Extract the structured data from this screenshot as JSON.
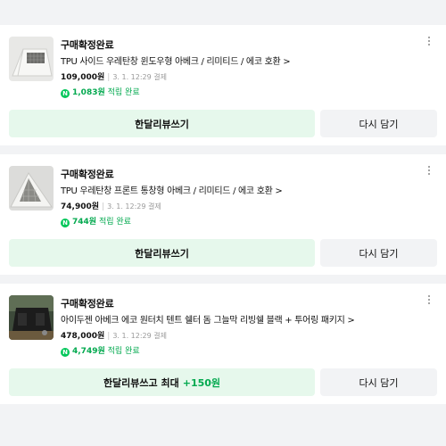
{
  "orders": [
    {
      "status": "구매확정완료",
      "title": "TPU 사이드 우레탄창 윈도우형 아베크 / 리미티드 / 에코 호환 >",
      "price": "109,000원",
      "date": "3. 1. 12:29 결제",
      "point_amount": "1,083원",
      "point_label": "적립 완료",
      "review_label": "한달리뷰쓰기",
      "review_bonus": "",
      "again_label": "다시 담기",
      "thumb_icon": "tent-window-product-image"
    },
    {
      "status": "구매확정완료",
      "title": "TPU 우레탄창 프론트 통창형 아베크 / 리미티드 / 에코 호환 >",
      "price": "74,900원",
      "date": "3. 1. 12:29 결제",
      "point_amount": "744원",
      "point_label": "적립 완료",
      "review_label": "한달리뷰쓰기",
      "review_bonus": "",
      "again_label": "다시 담기",
      "thumb_icon": "tent-front-window-product-image"
    },
    {
      "status": "구매확정완료",
      "title": "아이두젠 아베크 에코 원터치 텐트 쉘터 돔 그늘막 리빙쉘 블랙 + 투어링 패키지 >",
      "price": "478,000원",
      "date": "3. 1. 12:29 결제",
      "point_amount": "4,749원",
      "point_label": "적립 완료",
      "review_label": "한달리뷰쓰고 최대",
      "review_bonus": "+150원",
      "again_label": "다시 담기",
      "thumb_icon": "black-tent-product-image"
    }
  ],
  "colors": {
    "accent_green": "#03c75a",
    "review_button_bg": "#e6f8ec",
    "again_button_bg": "#f2f3f5"
  }
}
